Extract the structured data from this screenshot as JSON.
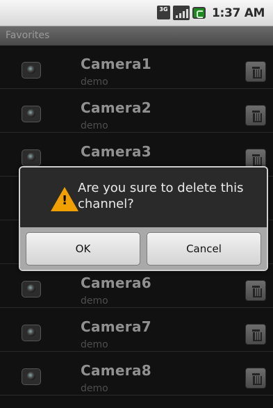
{
  "status_bar": {
    "network": "3G",
    "time": "1:37 AM"
  },
  "title_bar": {
    "title": "Favorites"
  },
  "list": {
    "items": [
      {
        "name": "Camera1",
        "subtitle": "demo"
      },
      {
        "name": "Camera2",
        "subtitle": "demo"
      },
      {
        "name": "Camera3",
        "subtitle": ""
      },
      {
        "name": "",
        "subtitle": ""
      },
      {
        "name": "",
        "subtitle": ""
      },
      {
        "name": "Camera6",
        "subtitle": "demo"
      },
      {
        "name": "Camera7",
        "subtitle": "demo"
      },
      {
        "name": "Camera8",
        "subtitle": "demo"
      }
    ]
  },
  "dialog": {
    "message": "Are you sure to delete this channel?",
    "ok_label": "OK",
    "cancel_label": "Cancel"
  },
  "colors": {
    "warning": "#f0a000",
    "battery": "#1f8a1f"
  }
}
